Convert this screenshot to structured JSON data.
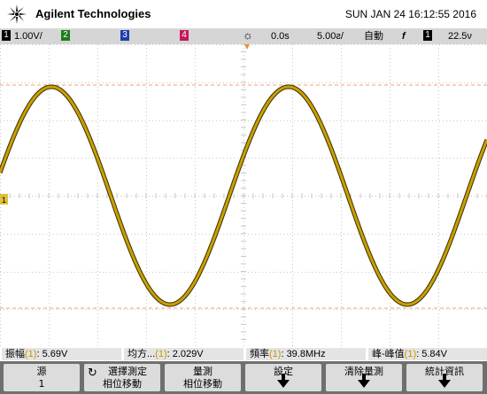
{
  "header": {
    "brand": "Agilent Technologies",
    "datetime": "SUN JAN 24 16:12:55 2016"
  },
  "status_bar": {
    "ch1_label": "1",
    "ch1_scale": "1.00V/",
    "ch2_label": "2",
    "ch3_label": "3",
    "ch4_label": "4",
    "acquire_icon": "☼",
    "time_position": "0.0s",
    "time_scale": "5.00ƨ/",
    "trigger_mode": "自動",
    "trigger_edge": "f",
    "trigger_source": "1",
    "trigger_level": "22.5ν"
  },
  "colors": {
    "waveform": "#c9a000",
    "waveform_edge": "#3a3000",
    "grid": "#c8c8c8",
    "cursor_line": "#f0a07a"
  },
  "waveform_markers": {
    "ground_marker": "1"
  },
  "measurements": [
    {
      "name": "振幅",
      "ch": "(1)",
      "value": ": 5.69V"
    },
    {
      "name": "均方...",
      "ch": "(1)",
      "value": ": 2.029V"
    },
    {
      "name": "頻率",
      "ch": "(1)",
      "value": ": 39.8MHz"
    },
    {
      "name": "峰-峰值",
      "ch": "(1)",
      "value": ": 5.84V"
    }
  ],
  "softkeys": [
    {
      "line1": "源",
      "line2": "1",
      "icon": ""
    },
    {
      "line1": "選擇測定",
      "line2": "相位移動",
      "icon": "↻"
    },
    {
      "line1": "量測",
      "line2": "相位移動",
      "icon": ""
    },
    {
      "line1": "設定",
      "line2": "",
      "icon": "down-arrow"
    },
    {
      "line1": "清除量測",
      "line2": "",
      "icon": "down-arrow"
    },
    {
      "line1": "統計資訊",
      "line2": "",
      "icon": "down-arrow"
    }
  ]
}
